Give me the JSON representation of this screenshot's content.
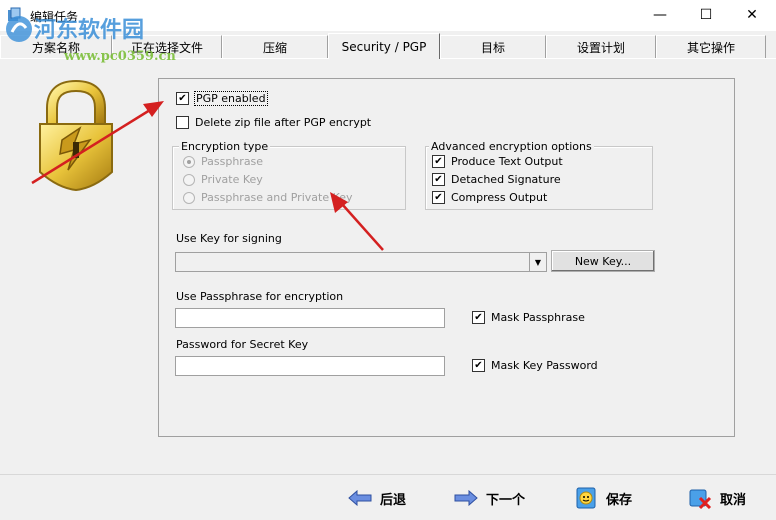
{
  "window": {
    "title": "编辑任务",
    "minimize_glyph": "—",
    "maximize_glyph": "☐",
    "close_glyph": "✕"
  },
  "watermark": {
    "text": "河东软件园",
    "url": "www.pc0359.cn"
  },
  "tabs": [
    {
      "label": "方案名称"
    },
    {
      "label": "正在选择文件"
    },
    {
      "label": "压缩"
    },
    {
      "label": "Security / PGP",
      "active": true
    },
    {
      "label": "目标"
    },
    {
      "label": "设置计划"
    },
    {
      "label": "其它操作"
    }
  ],
  "security": {
    "pgp_enabled": {
      "label": "PGP enabled",
      "checked": true
    },
    "delete_zip": {
      "label": "Delete zip file after PGP encrypt",
      "checked": false
    },
    "encryption_type": {
      "label": "Encryption type",
      "options": [
        "Passphrase",
        "Private Key",
        "Passphrase and Private Key"
      ],
      "selected": "Passphrase"
    },
    "advanced": {
      "label": "Advanced encryption options",
      "options": [
        {
          "label": "Produce Text Output",
          "checked": true
        },
        {
          "label": "Detached Signature",
          "checked": true
        },
        {
          "label": "Compress Output",
          "checked": true
        }
      ]
    },
    "signing_key": {
      "label": "Use Key for signing",
      "value": ""
    },
    "new_key_button": "New Key...",
    "passphrase": {
      "label": "Use Passphrase for encryption",
      "value": ""
    },
    "mask_passphrase": {
      "label": "Mask Passphrase",
      "checked": true
    },
    "secret_password": {
      "label": "Password for Secret Key",
      "value": ""
    },
    "mask_key_password": {
      "label": "Mask Key Password",
      "checked": true
    }
  },
  "footer": {
    "back": "后退",
    "next": "下一个",
    "save": "保存",
    "cancel": "取消"
  },
  "colors": {
    "annotation_arrow": "#d42020",
    "lock_gold": "#e8c33a"
  }
}
